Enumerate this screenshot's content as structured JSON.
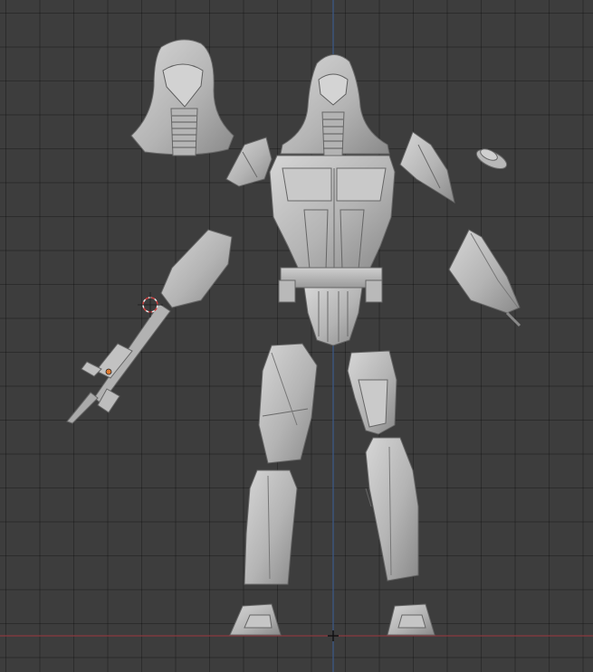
{
  "viewport": {
    "colors": {
      "background": "#3d3d3d",
      "grid_line": "#303030",
      "axis_x": "#8a3a3f",
      "axis_z": "#3d5a8a",
      "mesh_light": "#c8c8c8",
      "mesh_mid": "#a8a8a8",
      "mesh_dark": "#7a7a7a",
      "origin_marker": "#e06060"
    },
    "icons": {
      "cursor": "3d-cursor-icon",
      "origin": "object-origin-icon"
    }
  }
}
